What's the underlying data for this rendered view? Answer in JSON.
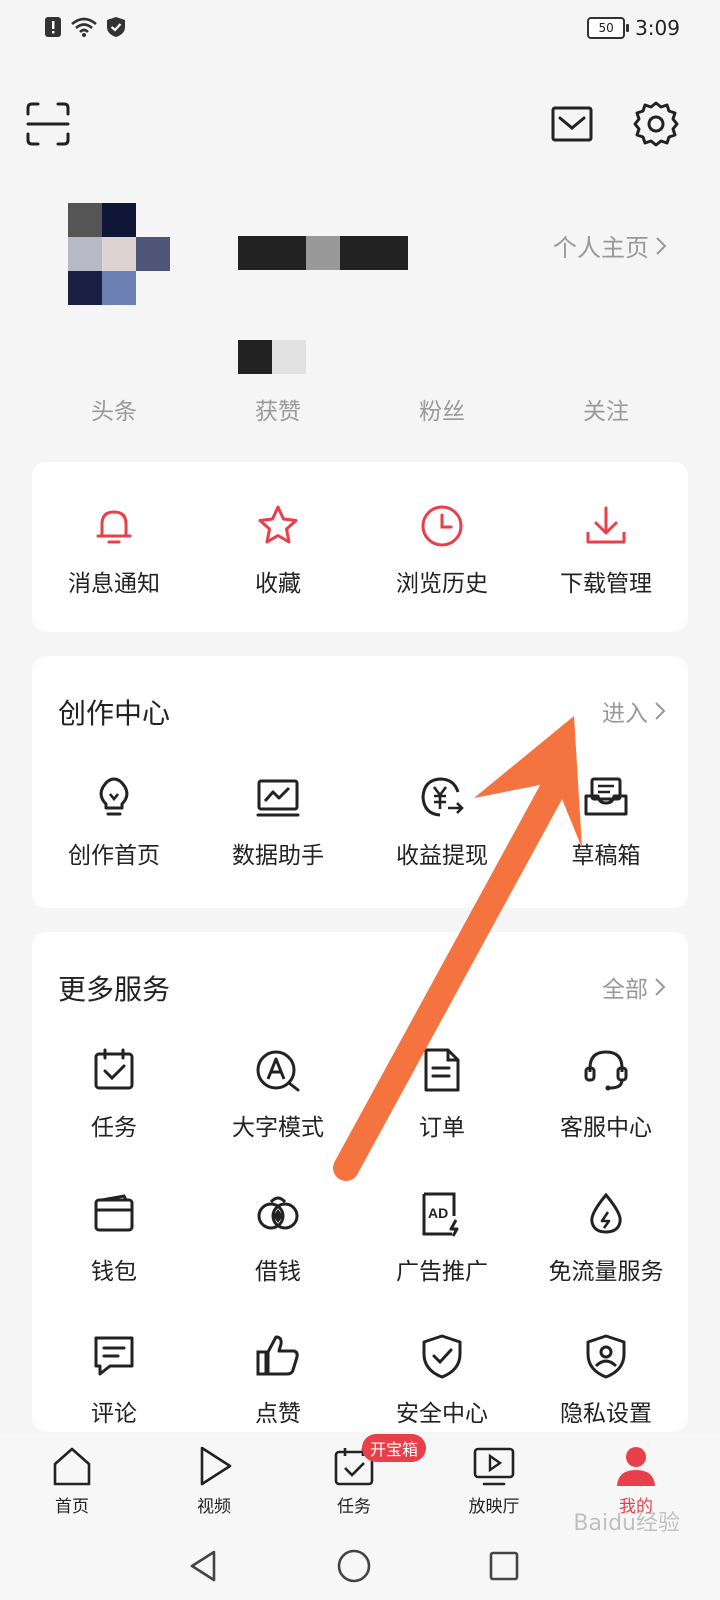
{
  "status_bar": {
    "time": "3:09",
    "battery": "50"
  },
  "profile": {
    "homepage_link": "个人主页",
    "stats": [
      "头条",
      "获赞",
      "粉丝",
      "关注"
    ]
  },
  "quick_actions": [
    {
      "label": "消息通知",
      "icon": "bell-icon"
    },
    {
      "label": "收藏",
      "icon": "star-icon"
    },
    {
      "label": "浏览历史",
      "icon": "clock-icon"
    },
    {
      "label": "下载管理",
      "icon": "download-icon"
    }
  ],
  "creator_center": {
    "title": "创作中心",
    "link": "进入",
    "items": [
      {
        "label": "创作首页",
        "icon": "lightbulb-icon"
      },
      {
        "label": "数据助手",
        "icon": "chart-monitor-icon"
      },
      {
        "label": "收益提现",
        "icon": "yuan-icon"
      },
      {
        "label": "草稿箱",
        "icon": "drafts-icon"
      }
    ]
  },
  "more_services": {
    "title": "更多服务",
    "link": "全部",
    "items": [
      {
        "label": "任务",
        "icon": "task-calendar-icon"
      },
      {
        "label": "大字模式",
        "icon": "large-font-icon"
      },
      {
        "label": "订单",
        "icon": "order-icon"
      },
      {
        "label": "客服中心",
        "icon": "headset-icon"
      },
      {
        "label": "钱包",
        "icon": "wallet-icon"
      },
      {
        "label": "借钱",
        "icon": "loan-icon"
      },
      {
        "label": "广告推广",
        "icon": "ad-icon"
      },
      {
        "label": "免流量服务",
        "icon": "data-drop-icon"
      },
      {
        "label": "评论",
        "icon": "comment-icon"
      },
      {
        "label": "点赞",
        "icon": "thumbs-up-icon"
      },
      {
        "label": "安全中心",
        "icon": "shield-check-icon"
      },
      {
        "label": "隐私设置",
        "icon": "privacy-shield-icon"
      }
    ]
  },
  "tab_bar": {
    "badge": "开宝箱",
    "tabs": [
      {
        "label": "首页",
        "icon": "home-icon"
      },
      {
        "label": "视频",
        "icon": "play-icon"
      },
      {
        "label": "任务",
        "icon": "task-icon"
      },
      {
        "label": "放映厅",
        "icon": "screen-icon"
      },
      {
        "label": "我的",
        "icon": "user-icon",
        "active": true
      }
    ]
  },
  "watermark": "Baidu经验",
  "colors": {
    "accent": "#e8404a",
    "arrow": "#f5733f",
    "background": "#f5f5f5"
  }
}
